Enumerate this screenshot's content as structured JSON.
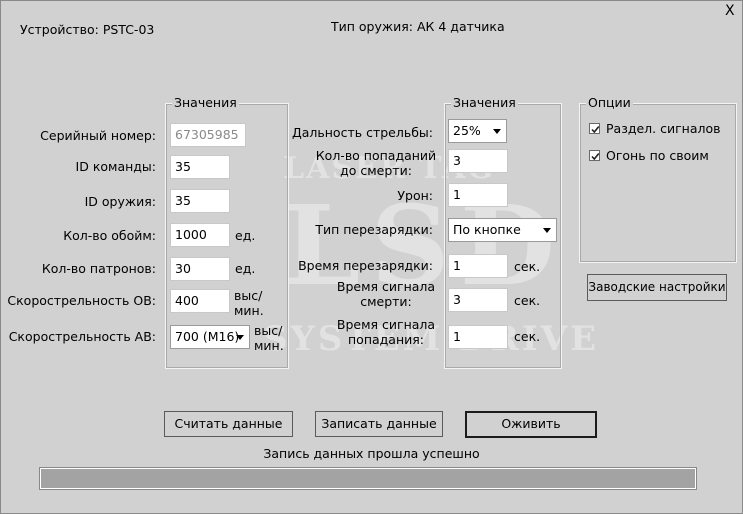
{
  "window": {
    "close_glyph": "X"
  },
  "header": {
    "device": "Устройство: PSTC-03",
    "weapon_type": "Тип оружия: АК 4 датчика"
  },
  "watermark": {
    "top": "LASER TAG",
    "logo": "LSD",
    "bottom": "SYSTEM DRIVE"
  },
  "group_left": {
    "title": "Значения",
    "serial": {
      "label": "Серийный номер:",
      "value": "67305985"
    },
    "team_id": {
      "label": "ID команды:",
      "value": "35"
    },
    "weapon_id": {
      "label": "ID оружия:",
      "value": "35"
    },
    "clips": {
      "label": "Кол-во обойм:",
      "value": "1000",
      "unit": "ед."
    },
    "rounds": {
      "label": "Кол-во патронов:",
      "value": "30",
      "unit": "ед."
    },
    "rate_single": {
      "label": "Скорострельность ОВ:",
      "value": "400",
      "unit_line1": "выс/",
      "unit_line2": "мин."
    },
    "rate_auto": {
      "label": "Скорострельность АВ:",
      "value": "700 (M16)",
      "unit_line1": "выс/",
      "unit_line2": "мин."
    }
  },
  "group_mid": {
    "title": "Значения",
    "range": {
      "label": "Дальность стрельбы:",
      "value": "25%"
    },
    "hits_to_death": {
      "label_line1": "Кол-во попаданий",
      "label_line2": "до смерти:",
      "value": "3"
    },
    "damage": {
      "label": "Урон:",
      "value": "1"
    },
    "reload_type": {
      "label": "Тип перезарядки:",
      "value": "По кнопке"
    },
    "reload_time": {
      "label": "Время перезарядки:",
      "value": "1",
      "unit": "сек."
    },
    "death_signal": {
      "label_line1": "Время сигнала",
      "label_line2": "смерти:",
      "value": "3",
      "unit": "сек."
    },
    "hit_signal": {
      "label_line1": "Время сигнала",
      "label_line2": "попадания:",
      "value": "1",
      "unit": "сек."
    }
  },
  "options": {
    "title": "Опции",
    "separate_signals": {
      "label": "Раздел. сигналов",
      "checked": true
    },
    "friendly_fire": {
      "label": "Огонь по своим",
      "checked": true
    }
  },
  "buttons": {
    "factory": "Заводские настройки",
    "read": "Считать данные",
    "write": "Записать данные",
    "revive": "Оживить"
  },
  "status": {
    "message": "Запись данных прошла успешно",
    "progress": 1.0
  },
  "colors": {
    "window_bg": "#d1d1d1",
    "progress_fill": "#a3a3a3",
    "watermark": "#e2e2e2"
  }
}
